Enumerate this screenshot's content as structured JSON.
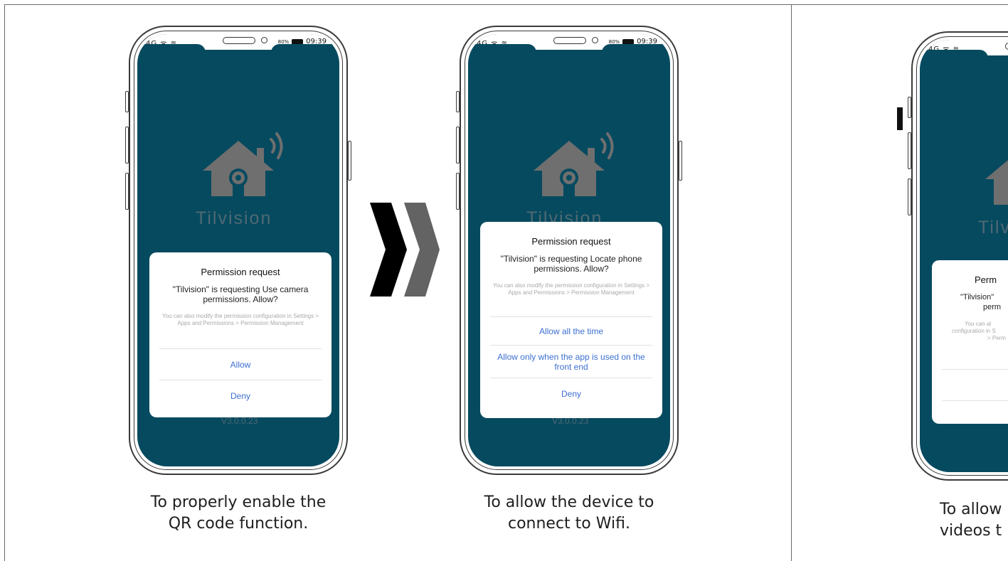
{
  "status_bar": {
    "left_icons": "4G ᯤ ≋",
    "battery_label": "80%",
    "time": "09:39"
  },
  "app": {
    "name": "Tilvision",
    "version": "V3.0.0.23"
  },
  "panels": [
    {
      "dialog": {
        "title": "Permission request",
        "message": "\"Tilvision\" is requesting Use camera permissions. Allow?",
        "note": "You can also modify the permission configuration in Settings > Apps and Permissions > Permission Management",
        "buttons": [
          "Allow",
          "Deny"
        ]
      },
      "caption_lines": [
        "To properly enable the",
        "QR code function."
      ]
    },
    {
      "dialog": {
        "title": "Permission request",
        "message": "\"Tilvision\" is requesting Locate phone permissions. Allow?",
        "note": "You can also modify the permission configuration in Settings > Apps and Permissions > Permission Management",
        "buttons": [
          "Allow all the time",
          "Allow only when the app is used on the front end",
          "Deny"
        ]
      },
      "caption_lines": [
        "To allow the device to",
        "connect to Wifi."
      ]
    },
    {
      "dialog": {
        "title": "Perm",
        "message_lines": [
          "\"Tilvision\"",
          "perm"
        ],
        "note_lines": [
          "You can al",
          "configuration in S",
          "> Perm"
        ]
      },
      "caption_lines": [
        "To allow",
        "videos t"
      ]
    }
  ],
  "colors": {
    "screen_bg": "#064a5f",
    "logo_gray": "#6f6f6f",
    "button_blue": "#3d6fd1",
    "chevron_black": "#000000",
    "chevron_gray": "#636363"
  },
  "icons": {
    "logo": "house-with-camera-and-wifi-icon",
    "step_arrow": "double-chevron-right-icon"
  }
}
